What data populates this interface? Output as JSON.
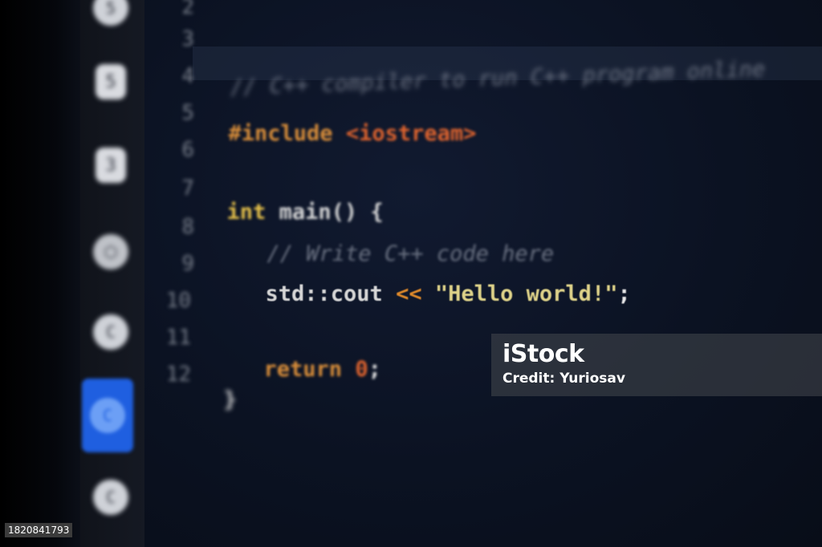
{
  "sidebar": {
    "icons": [
      "html5-icon",
      "css3-icon",
      "css3-icon",
      "nodejs-icon",
      "cplusplus-icon",
      "c-icon",
      "csharp-icon"
    ],
    "active_index": 5,
    "active_color": "#1f5fe0"
  },
  "editor": {
    "line_numbers": [
      "2",
      "3",
      "4",
      "5",
      "6",
      "7",
      "8",
      "9",
      "10",
      "11",
      "12"
    ],
    "lines": {
      "comment": "// C++ compiler to run C++ program online",
      "include_kw": "#include",
      "include_lib": "<iostream>",
      "main_type": "int",
      "main_sig": "main() {",
      "body_comment": "// Write C++ code here",
      "cout_ident": "std::cout",
      "cout_op": "<<",
      "cout_string": "\"Hello world!\"",
      "cout_end": ";",
      "return_kw": "return",
      "return_val": "0",
      "return_end": ";",
      "close_brace": "}"
    },
    "colors": {
      "background": "#0a0f1d",
      "keyword": "#d98e3a",
      "string": "#e0d48a"
    }
  },
  "watermark": {
    "logo": "iStock",
    "credit": "Credit: Yuriosav"
  },
  "image_id": "1820841793"
}
